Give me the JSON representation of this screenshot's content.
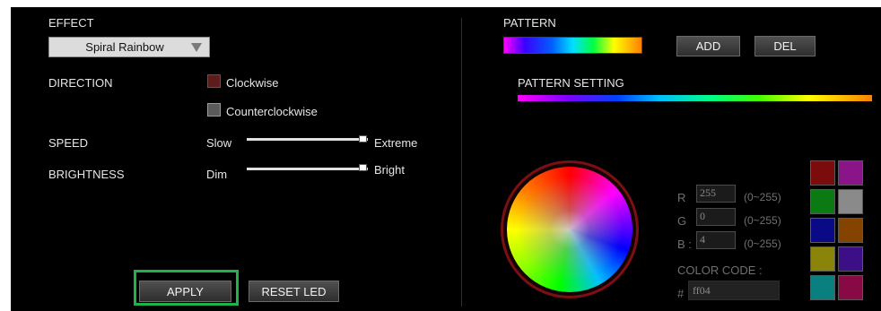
{
  "effect": {
    "label": "EFFECT",
    "selected": "Spiral Rainbow"
  },
  "direction": {
    "label": "DIRECTION",
    "options": [
      {
        "label": "Clockwise",
        "checked": true
      },
      {
        "label": "Counterclockwise",
        "checked": false
      }
    ]
  },
  "speed": {
    "label": "SPEED",
    "min_label": "Slow",
    "max_label": "Extreme",
    "value_fraction": 1.0
  },
  "brightness": {
    "label": "BRIGHTNESS",
    "min_label": "Dim",
    "max_label": "Bright",
    "value_fraction": 1.0
  },
  "buttons": {
    "apply": "APPLY",
    "reset": "RESET LED",
    "add": "ADD",
    "del": "DEL"
  },
  "pattern": {
    "label": "PATTERN",
    "setting_label": "PATTERN SETTING"
  },
  "rgb": {
    "r_label": "R",
    "g_label": "G",
    "b_label": "B :",
    "r_value": "255",
    "g_value": "0",
    "b_value": "4",
    "range_hint": "(0~255)"
  },
  "color_code": {
    "label": "COLOR CODE :",
    "prefix": "#",
    "value": "ff04"
  },
  "swatches": [
    {
      "name": "dark-red",
      "color": "#7a0c0c"
    },
    {
      "name": "purple",
      "color": "#8a1589"
    },
    {
      "name": "green",
      "color": "#0c7a12"
    },
    {
      "name": "gray",
      "color": "#8a8a8a"
    },
    {
      "name": "navy",
      "color": "#0b0a86"
    },
    {
      "name": "brown-orange",
      "color": "#844400"
    },
    {
      "name": "olive",
      "color": "#8a850a"
    },
    {
      "name": "indigo",
      "color": "#3d0f86"
    },
    {
      "name": "teal",
      "color": "#0a7f7f"
    },
    {
      "name": "crimson",
      "color": "#870a45"
    }
  ],
  "accent": {
    "highlight": "#1fb24a",
    "checkbox_on": "#5e1b1b"
  }
}
